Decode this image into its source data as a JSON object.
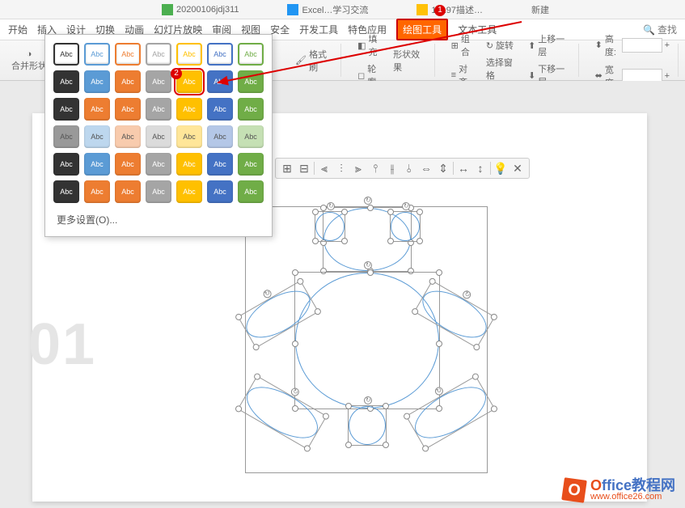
{
  "tabs": [
    {
      "label": "20200106jdj311",
      "color": "green"
    },
    {
      "label": "Excel…学习交流",
      "color": "blue"
    },
    {
      "label": "19197描述…",
      "color": "yellow"
    }
  ],
  "new_tab": "新建",
  "menu": {
    "items": [
      "开始",
      "插入",
      "设计",
      "切换",
      "动画",
      "幻灯片放映",
      "审阅",
      "视图",
      "安全",
      "开发工具",
      "特色应用"
    ],
    "active": "绘图工具",
    "after": [
      "文本工具"
    ],
    "search": "查找"
  },
  "callouts": {
    "one": "1",
    "two": "2"
  },
  "ribbon": {
    "merge_shapes": "合并形状",
    "fill": "填充",
    "outline": "轮廓",
    "shape_effects": "形状效果",
    "format_painter": "格式刷",
    "align": "对齐",
    "group": "组合",
    "rotate": "旋转",
    "selection_pane": "选择窗格",
    "bring_forward": "上移一层",
    "send_backward": "下移一层",
    "height": "高度:",
    "width": "宽度:"
  },
  "gallery": {
    "swatch_label": "Abc",
    "more": "更多设置(O)...",
    "rows": [
      {
        "type": "outline",
        "colors": [
          "#333",
          "#5B9BD5",
          "#ED7D31",
          "#A5A5A5",
          "#FFC000",
          "#4472C4",
          "#70AD47"
        ]
      },
      {
        "type": "solid",
        "colors": [
          "#333",
          "#5B9BD5",
          "#ED7D31",
          "#A5A5A5",
          "#FFC000",
          "#4472C4",
          "#70AD47"
        ]
      },
      {
        "type": "solid",
        "colors": [
          "#333",
          "#ED7D31",
          "#ED7D31",
          "#A5A5A5",
          "#FFC000",
          "#4472C4",
          "#70AD47"
        ]
      },
      {
        "type": "light",
        "colors": [
          "#999",
          "#BDD7EE",
          "#F8CBAD",
          "#DBDBDB",
          "#FFE699",
          "#B4C7E7",
          "#C5E0B4"
        ]
      },
      {
        "type": "solid",
        "colors": [
          "#333",
          "#5B9BD5",
          "#ED7D31",
          "#A5A5A5",
          "#FFC000",
          "#4472C4",
          "#70AD47"
        ]
      },
      {
        "type": "solid",
        "colors": [
          "#333",
          "#ED7D31",
          "#ED7D31",
          "#A5A5A5",
          "#FFC000",
          "#4472C4",
          "#70AD47"
        ]
      }
    ],
    "selected": {
      "row": 1,
      "col": 4
    }
  },
  "slide": {
    "number": "01"
  },
  "watermark": {
    "title_accent": "O",
    "title_rest": "ffice教程网",
    "url": "www.office26.com"
  }
}
